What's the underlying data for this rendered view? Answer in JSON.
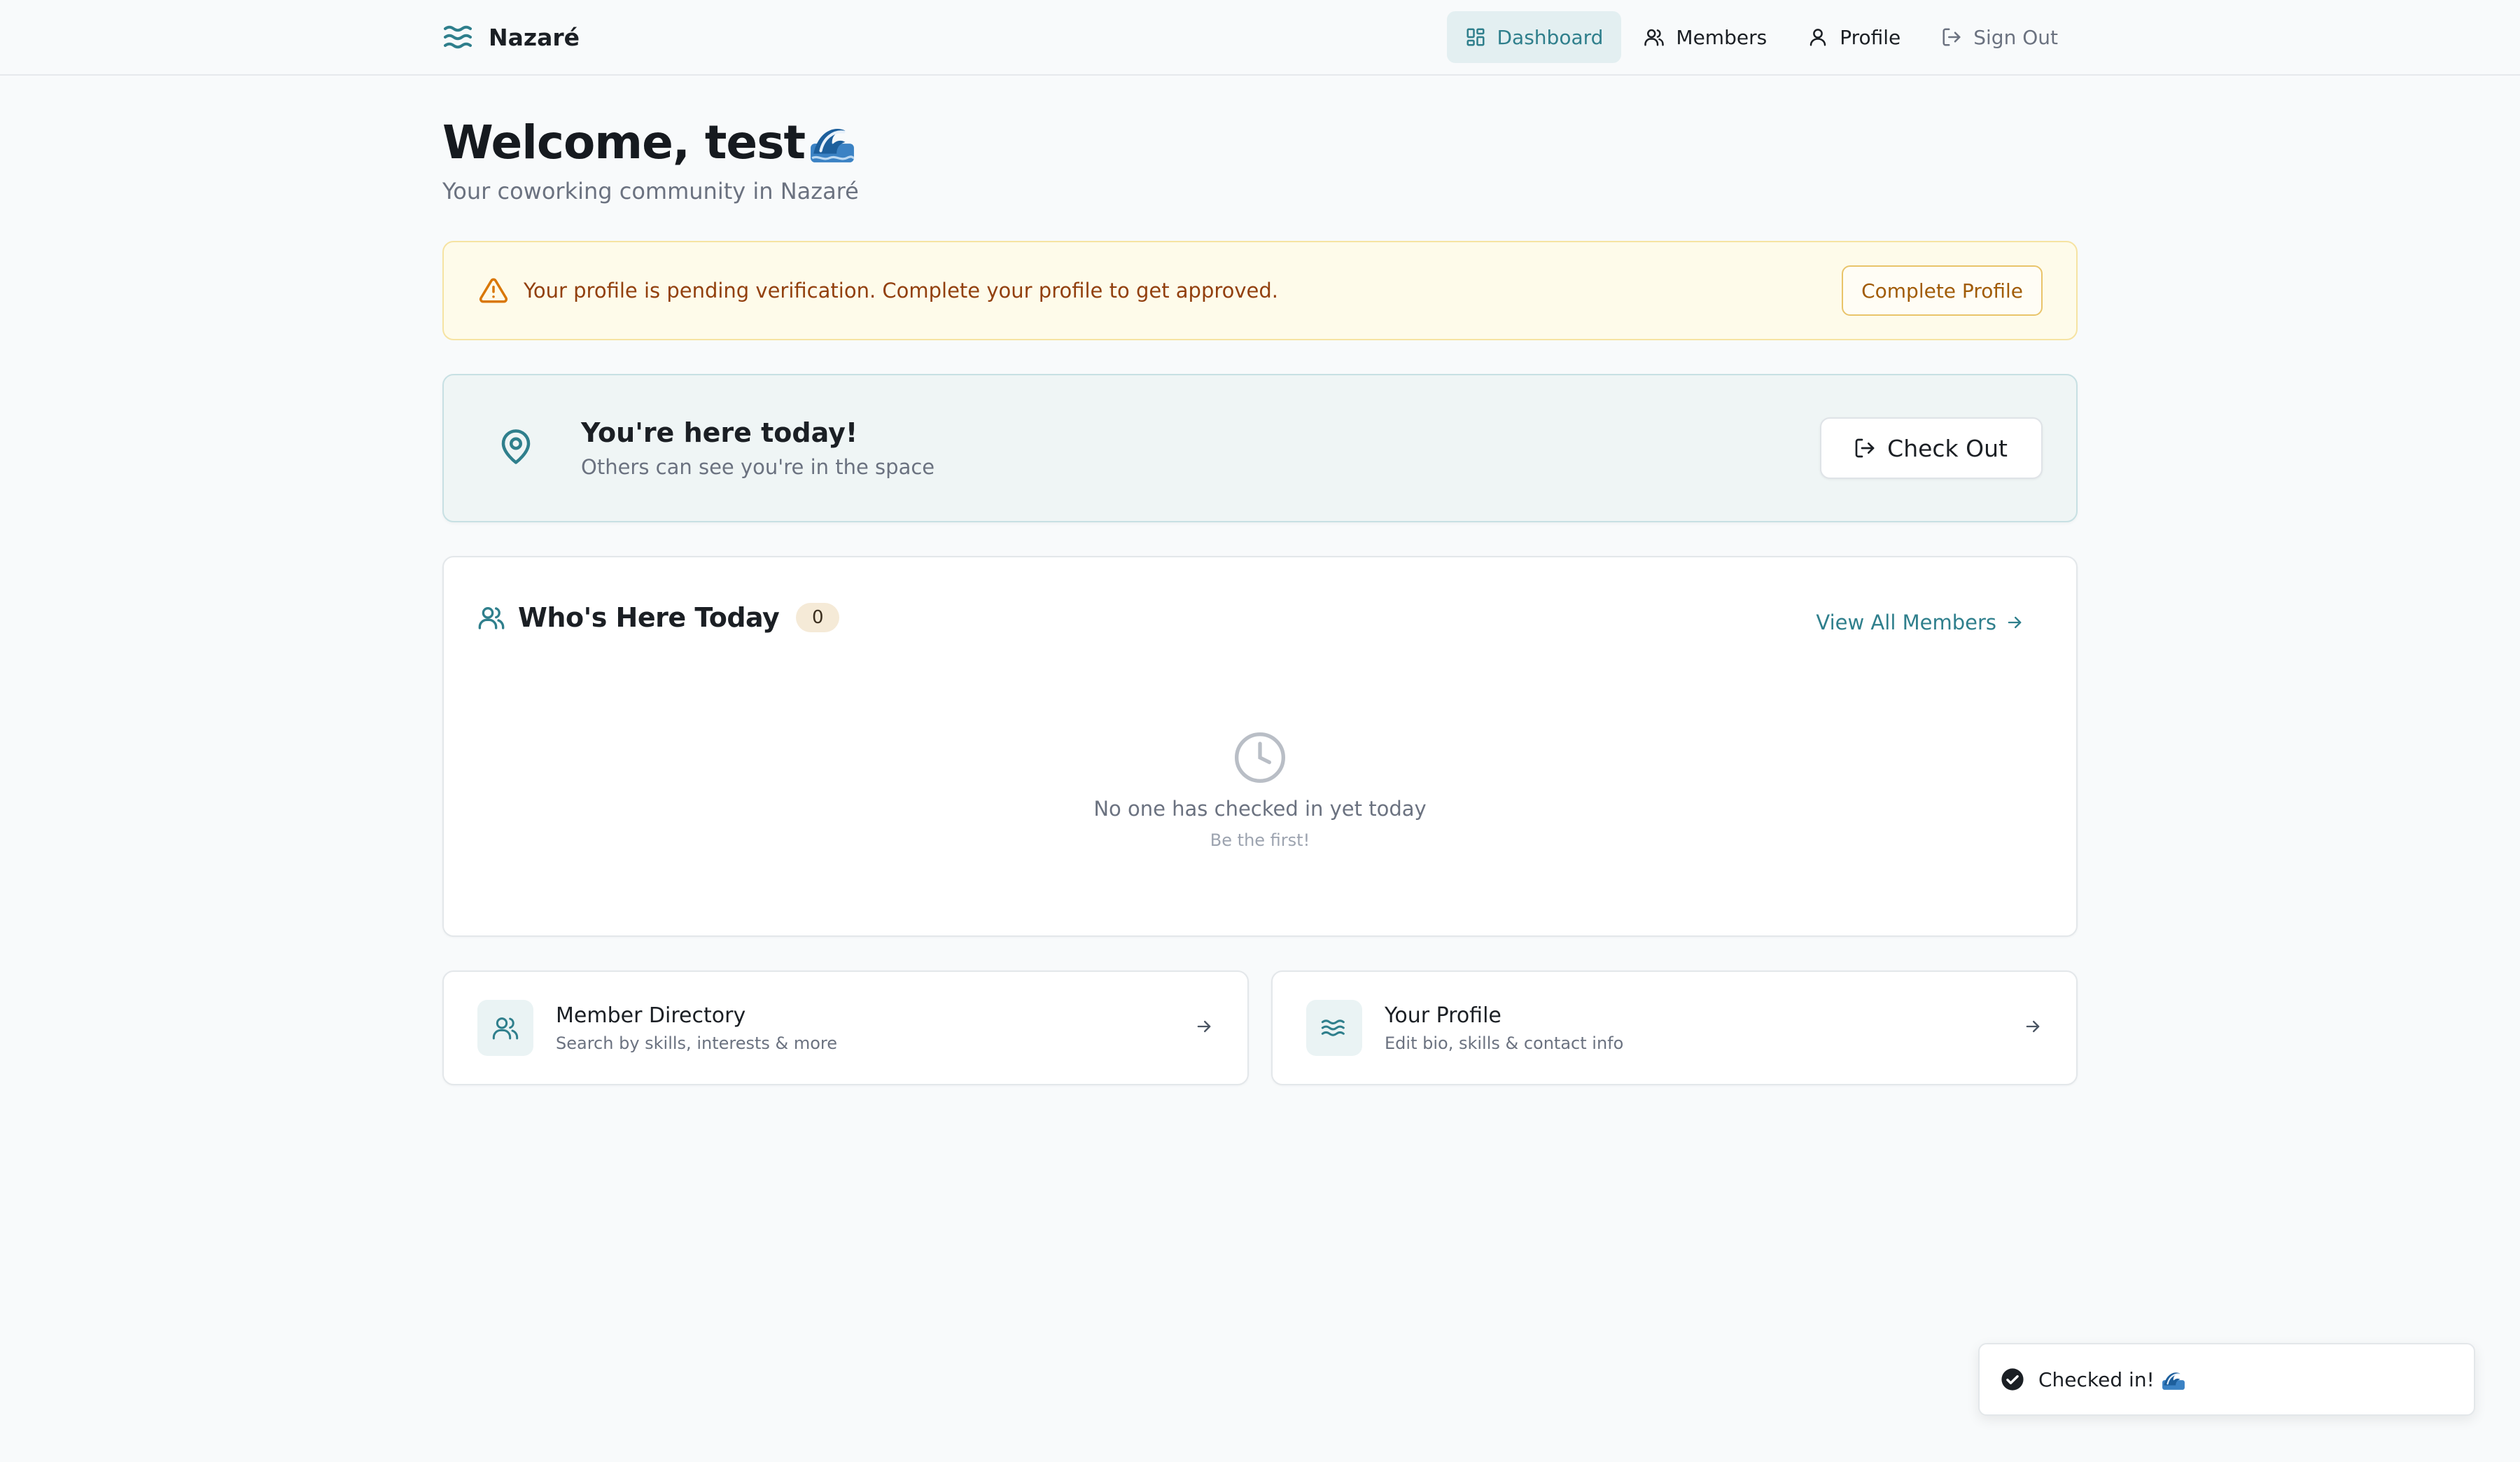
{
  "header": {
    "brand": "Nazaré",
    "nav": [
      {
        "label": "Dashboard",
        "icon": "dashboard-icon",
        "active": true
      },
      {
        "label": "Members",
        "icon": "members-icon"
      },
      {
        "label": "Profile",
        "icon": "profile-icon"
      },
      {
        "label": "Sign Out",
        "icon": "sign-out-icon"
      }
    ]
  },
  "welcome": {
    "title": "Welcome, test",
    "subtitle": "Your coworking community in Nazaré"
  },
  "alert": {
    "message": "Your profile is pending verification. Complete your profile to get approved.",
    "button": "Complete Profile",
    "icon": "warning-icon"
  },
  "checkin": {
    "title": "You're here today!",
    "subtitle": "Others can see you're in the space",
    "button": "Check Out",
    "icon": "map-pin-icon"
  },
  "here_today": {
    "title": "Who's Here Today",
    "count": "0",
    "view_all": "View All Members",
    "empty_title": "No one has checked in yet today",
    "empty_sub": "Be the first!"
  },
  "quick_links": [
    {
      "title": "Member Directory",
      "subtitle": "Search by skills, interests & more",
      "icon": "users-icon"
    },
    {
      "title": "Your Profile",
      "subtitle": "Edit bio, skills & contact info",
      "icon": "waves-icon"
    }
  ],
  "toast": {
    "message": "Checked in!",
    "icon": "check-circle-icon"
  },
  "colors": {
    "accent": "#2f7f8c",
    "warning": "#b45309",
    "background": "#f8fafb"
  }
}
